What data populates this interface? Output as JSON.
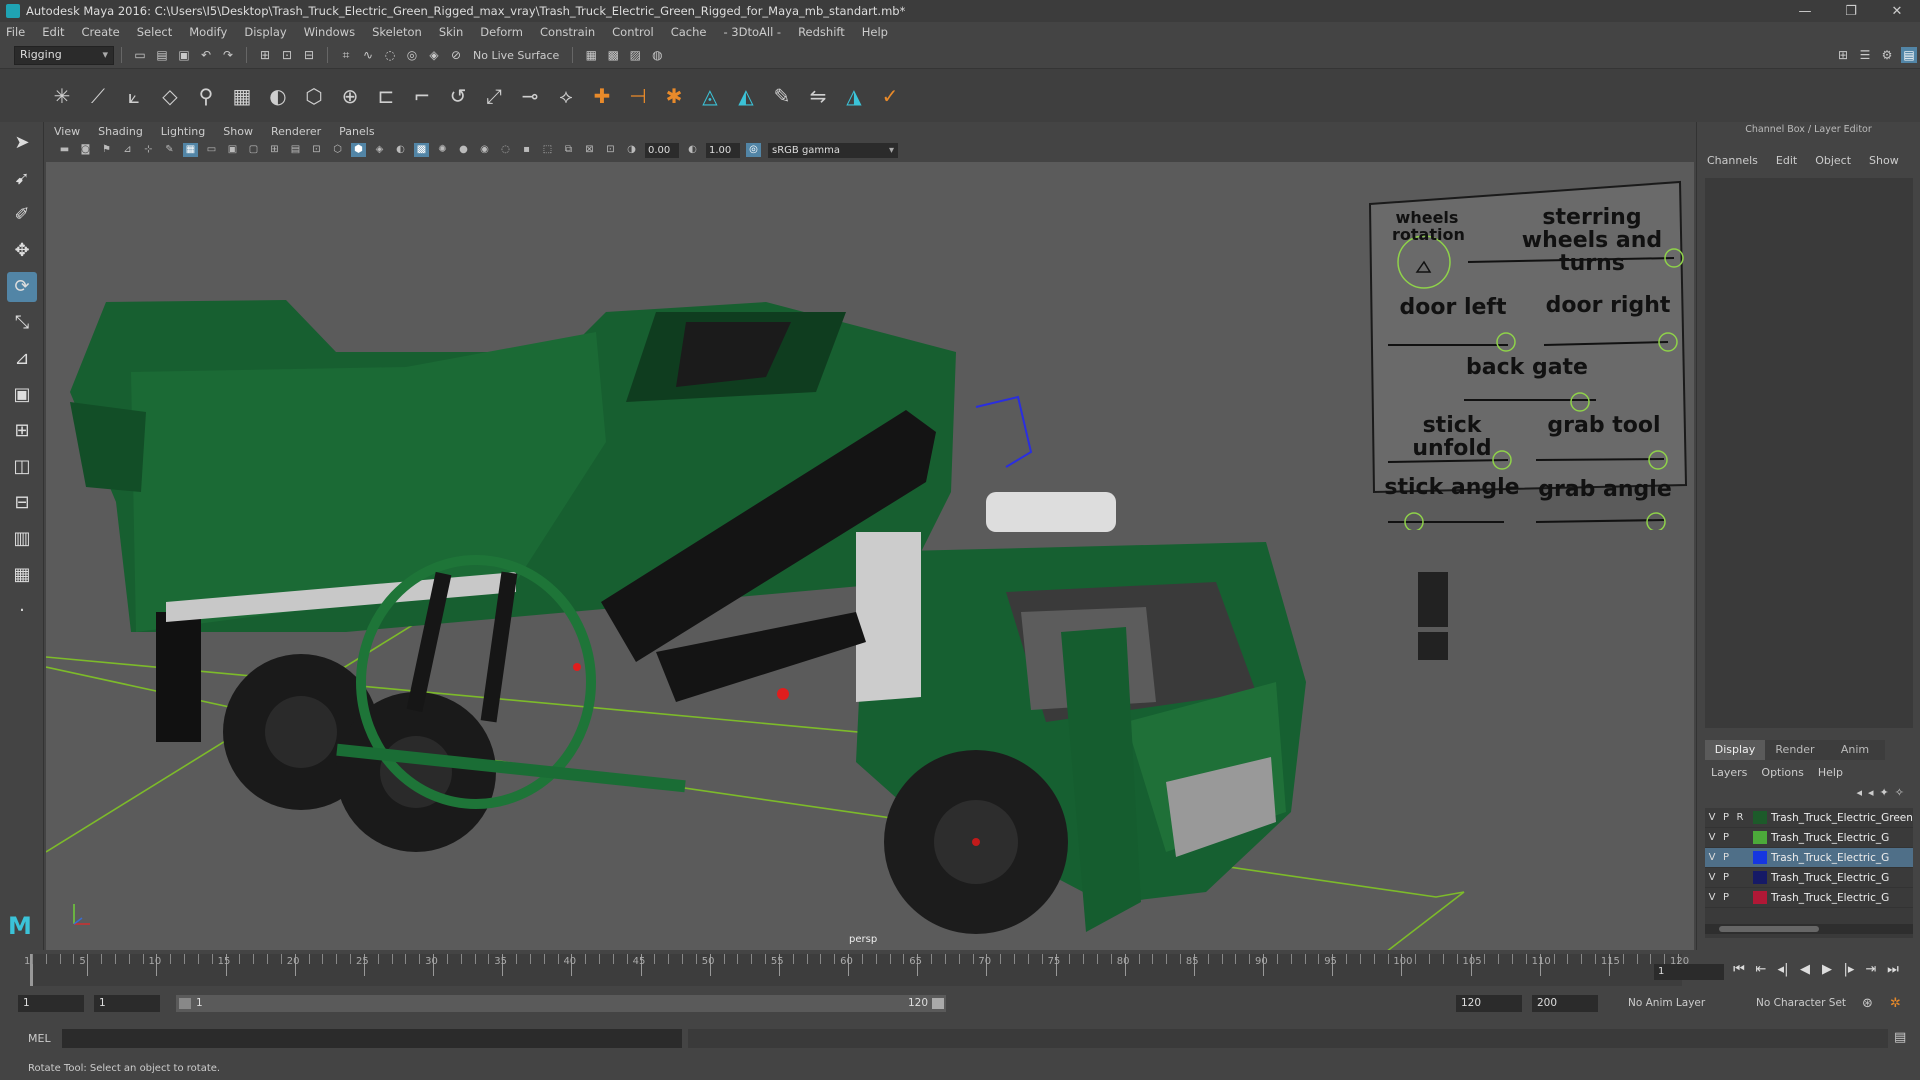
{
  "window": {
    "title": "Autodesk Maya 2016: C:\\Users\\I5\\Desktop\\Trash_Truck_Electric_Green_Rigged_max_vray\\Trash_Truck_Electric_Green_Rigged_for_Maya_mb_standart.mb*",
    "minimize": "—",
    "maximize": "❐",
    "close": "✕"
  },
  "menubar": [
    "File",
    "Edit",
    "Create",
    "Select",
    "Modify",
    "Display",
    "Windows",
    "Skeleton",
    "Skin",
    "Deform",
    "Constrain",
    "Control",
    "Cache",
    "- 3DtoAll -",
    "Redshift",
    "Help"
  ],
  "shelf": {
    "mode": "Rigging",
    "live_surface": "No Live Surface"
  },
  "viewport": {
    "menu": [
      "View",
      "Shading",
      "Lighting",
      "Show",
      "Renderer",
      "Panels"
    ],
    "exposure": "0.00",
    "gamma": "1.00",
    "color_space": "sRGB gamma",
    "camera_label": "persp"
  },
  "control_panel": {
    "wheels_rotation": "wheels rotation",
    "steering": "sterring wheels and turns",
    "door_left": "door left",
    "door_right": "door right",
    "back_gate": "back gate",
    "stick_unfold": "stick unfold",
    "grab_tool": "grab tool",
    "stick_angle": "stick angle",
    "grab_angle": "grab angle"
  },
  "channel_box": {
    "title": "Channel Box / Layer Editor",
    "menu": [
      "Channels",
      "Edit",
      "Object",
      "Show"
    ]
  },
  "layer_editor": {
    "tabs": [
      "Display",
      "Render",
      "Anim"
    ],
    "menu": [
      "Layers",
      "Options",
      "Help"
    ],
    "layers": [
      {
        "v": "V",
        "p": "P",
        "r": "R",
        "color": "#1d5a2a",
        "name": "Trash_Truck_Electric_Green"
      },
      {
        "v": "V",
        "p": "P",
        "r": "",
        "color": "#4caa3a",
        "name": "Trash_Truck_Electric_G"
      },
      {
        "v": "V",
        "p": "P",
        "r": "",
        "color": "#1636e0",
        "name": "Trash_Truck_Electric_G"
      },
      {
        "v": "V",
        "p": "P",
        "r": "",
        "color": "#161a66",
        "name": "Trash_Truck_Electric_G"
      },
      {
        "v": "V",
        "p": "P",
        "r": "",
        "color": "#b01836",
        "name": "Trash_Truck_Electric_G"
      }
    ]
  },
  "timeline": {
    "ticks": [
      "1",
      "5",
      "10",
      "15",
      "20",
      "25",
      "30",
      "35",
      "40",
      "45",
      "50",
      "55",
      "60",
      "65",
      "70",
      "75",
      "80",
      "85",
      "90",
      "95",
      "100",
      "105",
      "110",
      "115",
      "120"
    ],
    "current_frame": "1"
  },
  "range": {
    "start": "1",
    "anim_start": "1",
    "slider_start": "1",
    "slider_end": "120",
    "end": "120",
    "anim_end": "200",
    "anim_layer": "No Anim Layer",
    "char_set": "No Character Set"
  },
  "command": {
    "mel_label": "MEL"
  },
  "status": "Rotate Tool: Select an object to rotate."
}
